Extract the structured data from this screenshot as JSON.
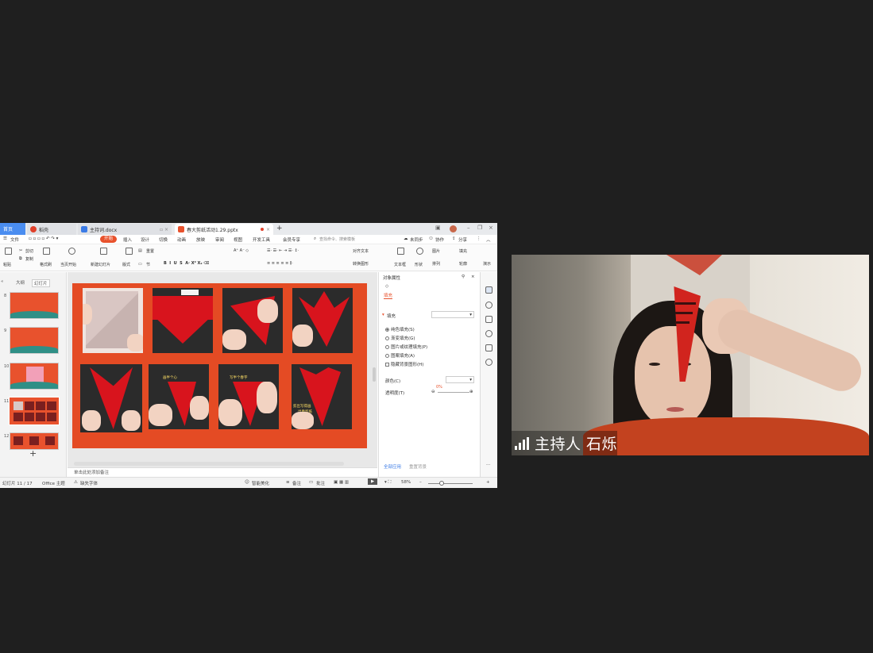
{
  "tabs": {
    "home": "首页",
    "doc1": "稻壳",
    "doc2": "主持词.docx",
    "doc3": "春大剪纸活动1.29.pptx"
  },
  "menu": {
    "file": "文件",
    "items": [
      "开始",
      "插入",
      "设计",
      "切换",
      "动画",
      "放映",
      "审阅",
      "视图",
      "开发工具",
      "会员专享"
    ],
    "search_placeholder": "查找命令、搜索模板",
    "sync": "未同步",
    "collab": "协作",
    "share": "分享"
  },
  "ribbon": {
    "paste": "粘贴",
    "cut": "剪切",
    "copy": "复制",
    "format_painter": "格式刷",
    "play_from_current": "当页开始",
    "new_slide": "新建幻灯片",
    "layout": "版式",
    "section": "节",
    "reset": "重置",
    "align_text": "对齐文本",
    "convert_smartart": "转换图形",
    "textbox": "文本框",
    "shape": "形状",
    "picture": "图片",
    "fill": "填充",
    "arrange": "排列",
    "outline": "轮廓",
    "more": "演示"
  },
  "left_pane": {
    "tab_outline": "大纲",
    "tab_slides": "幻灯片",
    "thumbnails": [
      "8",
      "9",
      "10",
      "11",
      "12"
    ],
    "selected": "11"
  },
  "slide": {
    "labels": [
      "画半个心",
      "写半个春字",
      "剪出写得画",
      "出春剪纸"
    ]
  },
  "notes": "单击此处添加备注",
  "properties": {
    "title": "对象属性",
    "fill_tab": "填充",
    "fill_section": "填充",
    "options": [
      "纯色填充(S)",
      "渐变填充(G)",
      "图片或纹理填充(P)",
      "图案填充(A)"
    ],
    "hide_bg": "隐藏背景图形(H)",
    "color": "颜色(C)",
    "transparency": "透明度(T)",
    "transparency_value": "0%",
    "apply_all": "全部应用",
    "reset_bg": "重置背景"
  },
  "status": {
    "slide_info": "幻灯片 11 / 17",
    "theme": "Office 主题",
    "missing_font": "缺失字体",
    "beautify": "智能美化",
    "notes": "备注",
    "comment": "批注",
    "zoom": "58%"
  },
  "video": {
    "name": "主持人 石烁"
  },
  "colors": {
    "accent": "#e8522d",
    "slide_bg": "#e44b24",
    "tab_home": "#4a8df0"
  }
}
